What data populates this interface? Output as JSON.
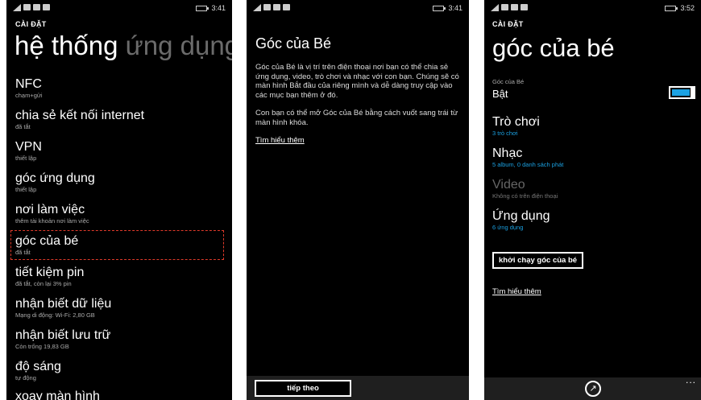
{
  "screen1": {
    "status_time": "3:41",
    "caption": "CÀI ĐẶT",
    "title_main": "hệ thống",
    "title_dim": "ứng dụng",
    "items": [
      {
        "title": "NFC",
        "sub": "chạm+gửi"
      },
      {
        "title": "chia sẻ kết nối internet",
        "sub": "đã tắt"
      },
      {
        "title": "VPN",
        "sub": "thiết lập"
      },
      {
        "title": "góc ứng dụng",
        "sub": "thiết lập"
      },
      {
        "title": "nơi làm việc",
        "sub": "thêm tài khoản nơi làm việc"
      },
      {
        "title": "góc của bé",
        "sub": "đã tắt"
      },
      {
        "title": "tiết kiệm pin",
        "sub": "đã tắt, còn lại 3% pin"
      },
      {
        "title": "nhận biết dữ liệu",
        "sub": "Mạng di động: Wi-Fi: 2,80 GB"
      },
      {
        "title": "nhận biết lưu trữ",
        "sub": "Còn trống 19,83 GB"
      },
      {
        "title": "độ sáng",
        "sub": "tự động"
      },
      {
        "title": "xoay màn hình",
        "sub": ""
      }
    ]
  },
  "screen2": {
    "status_time": "3:41",
    "title": "Góc của Bé",
    "paragraph1": "Góc của Bé là vị trí trên điện thoại nơi bạn có thể chia sẻ ứng dụng, video, trò chơi và nhạc với con bạn. Chúng sẽ có màn hình Bắt đầu của riêng mình và dễ dàng truy cập vào các mục bạn thêm ở đó.",
    "paragraph2": "Con bạn có thể mở Góc của Bé bằng cách vuốt sang trái từ màn hình khóa.",
    "learn_more": "Tìm hiểu thêm",
    "next_button": "tiếp theo"
  },
  "screen3": {
    "status_time": "3:52",
    "caption": "CÀI ĐẶT",
    "title": "góc của bé",
    "toggle_label": "Góc của Bé",
    "toggle_state": "Bật",
    "toggle_on": true,
    "items": [
      {
        "title": "Trò chơi",
        "sub": "3 trò chơi",
        "disabled": false
      },
      {
        "title": "Nhạc",
        "sub": "5 album, 0 danh sách phát",
        "disabled": false
      },
      {
        "title": "Video",
        "sub": "Không có trên điện thoại",
        "disabled": true
      },
      {
        "title": "Ứng dụng",
        "sub": "6 ứng dụng",
        "disabled": false
      }
    ],
    "launch_button": "khởi chạy góc của bé",
    "learn_more": "Tìm hiểu thêm",
    "more": "...",
    "accent_color": "#1ba1e2"
  },
  "highlight_color": "#e03a2a",
  "icons": [
    "signal-icon",
    "wifi-icon",
    "battery-icon",
    "pin-icon",
    "more-icon"
  ]
}
